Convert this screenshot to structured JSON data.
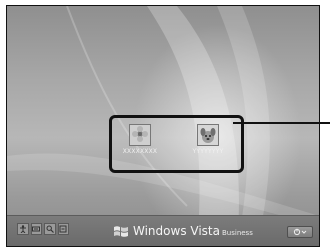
{
  "users": [
    {
      "name": "XXXXXXXX",
      "icon": "flower-icon"
    },
    {
      "name": "YYYYYYYY",
      "icon": "dog-icon"
    }
  ],
  "branding": {
    "logo": "windows-flag-icon",
    "product": "Windows Vista",
    "edition": "Business"
  },
  "taskbar": {
    "ease_of_access": [
      "accessibility-icon",
      "keyboard-icon",
      "magnifier-icon",
      "narrator-icon"
    ],
    "power": "power-icon"
  },
  "colors": {
    "screen": "#a7a7a7",
    "highlight_border": "#111111"
  }
}
